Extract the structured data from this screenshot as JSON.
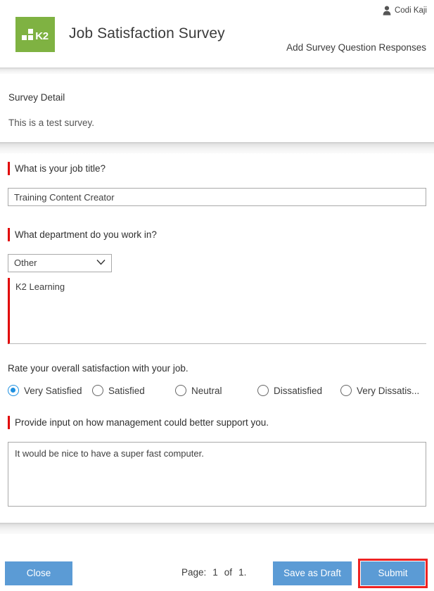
{
  "header": {
    "logo_text": "K2",
    "logo_icon": "k2-logo",
    "app_title": "Job Satisfaction Survey",
    "user_name": "Codi Kaji",
    "user_icon": "person-icon",
    "action_link": "Add Survey Question Responses",
    "brand_color": "#7fb242"
  },
  "detail": {
    "title": "Survey Detail",
    "text": "This is a test survey."
  },
  "questions": {
    "q1": {
      "label": "What is your job title?",
      "required": true,
      "value": "Training Content Creator",
      "placeholder": ""
    },
    "q2": {
      "label": "What department do you work in?",
      "required": true,
      "selected": "Other",
      "options": [
        "Other"
      ],
      "chevron_icon": "chevron-down-icon",
      "other_value": "K2 Learning",
      "other_placeholder": ""
    },
    "q3": {
      "label": "Rate your overall satisfaction with your job.",
      "required": false,
      "options": [
        {
          "label": "Very Satisfied",
          "checked": true
        },
        {
          "label": "Satisfied",
          "checked": false
        },
        {
          "label": "Neutral",
          "checked": false
        },
        {
          "label": "Dissatisfied",
          "checked": false
        },
        {
          "label": "Very Dissatis...",
          "checked": false
        }
      ],
      "accent_color": "#1e90e0"
    },
    "q4": {
      "label": "Provide input on how management could better support you.",
      "required": true,
      "value": "It would be nice to have a super fast computer.",
      "placeholder": ""
    }
  },
  "footer": {
    "close_label": "Close",
    "page_word": "Page:",
    "page_current": "1",
    "page_of": "of",
    "page_total": "1.",
    "draft_label": "Save as Draft",
    "submit_label": "Submit",
    "button_color": "#5b9bd5",
    "highlight_color": "#ee2222"
  }
}
